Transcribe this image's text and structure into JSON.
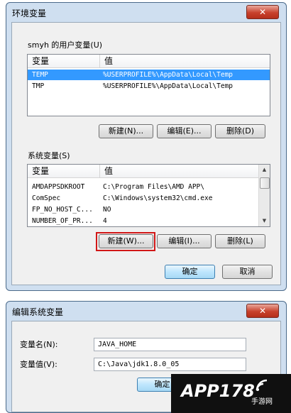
{
  "env_dialog": {
    "title": "环境变量",
    "close_label": "✕",
    "user_group_label": "smyh 的用户变量(U)",
    "user_columns": [
      "变量",
      "值"
    ],
    "user_rows": [
      {
        "name": "TEMP",
        "value": "%USERPROFILE%\\AppData\\Local\\Temp",
        "selected": true
      },
      {
        "name": "TMP",
        "value": "%USERPROFILE%\\AppData\\Local\\Temp",
        "selected": false
      }
    ],
    "user_buttons": {
      "new": "新建(N)...",
      "edit": "编辑(E)...",
      "delete": "删除(D)"
    },
    "system_group_label": "系统变量(S)",
    "system_columns": [
      "变量",
      "值"
    ],
    "system_rows": [
      {
        "name": "AMDAPPSDKROOT",
        "value": "C:\\Program Files\\AMD APP\\"
      },
      {
        "name": "ComSpec",
        "value": "C:\\Windows\\system32\\cmd.exe"
      },
      {
        "name": "FP_NO_HOST_C...",
        "value": "NO"
      },
      {
        "name": "NUMBER_OF_PR...",
        "value": "4"
      }
    ],
    "system_buttons": {
      "new": "新建(W)...",
      "edit": "编辑(I)...",
      "delete": "删除(L)"
    },
    "ok_label": "确定",
    "cancel_label": "取消"
  },
  "edit_dialog": {
    "title": "编辑系统变量",
    "close_label": "✕",
    "name_label": "变量名(N):",
    "name_value": "JAVA_HOME",
    "value_label": "变量值(V):",
    "value_value": "C:\\Java\\jdk1.8.0_05",
    "ok_label": "确定"
  },
  "watermark": {
    "brand": "APP178",
    "sub": "手游网"
  },
  "colors": {
    "selection": "#3399ff",
    "highlight": "#d11717",
    "close": "#c8412c"
  }
}
